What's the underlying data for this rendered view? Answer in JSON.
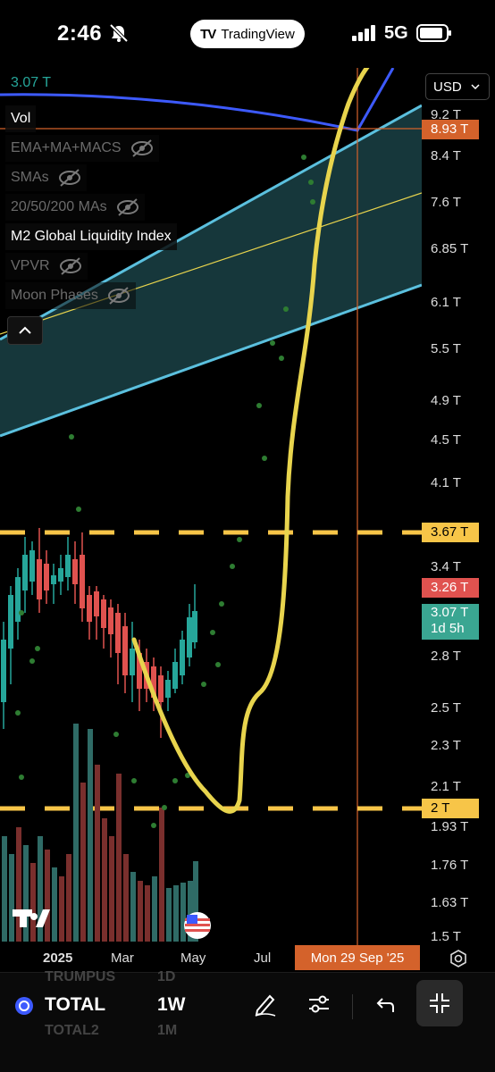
{
  "status_bar": {
    "time": "2:46",
    "app_name": "TradingView",
    "network": "5G"
  },
  "chart": {
    "legend_last_value": "3.07 T",
    "indicators": [
      {
        "name": "Vol",
        "visible": true
      },
      {
        "name": "EMA+MA+MACS",
        "visible": false
      },
      {
        "name": "SMAs",
        "visible": false
      },
      {
        "name": "20/50/200 MAs",
        "visible": false
      },
      {
        "name": "M2 Global Liquidity Index",
        "visible": true
      },
      {
        "name": "VPVR",
        "visible": false
      },
      {
        "name": "Moon Phases",
        "visible": false
      }
    ],
    "colors": {
      "up": "#26a69a",
      "down": "#e0524f",
      "liquidity_line": "#e8d44d",
      "channel": "#5bc0de",
      "dash": "#f7c548",
      "crosshair": "#d4622b",
      "ma_blue": "#3d5afe"
    }
  },
  "price_axis": {
    "currency": "USD",
    "ticks": [
      "9.2 T",
      "8.4 T",
      "7.6 T",
      "6.85 T",
      "6.1 T",
      "5.5 T",
      "4.9 T",
      "4.5 T",
      "4.1 T",
      "3.4 T",
      "2.8 T",
      "2.5 T",
      "2.3 T",
      "2.1 T",
      "1.93 T",
      "1.76 T",
      "1.63 T",
      "1.5 T"
    ],
    "crosshair_value": "8.93 T",
    "upper_level": "3.67 T",
    "lower_level": "2 T",
    "prev_close": "3.26 T",
    "last_price": "3.07 T",
    "countdown": "1d 5h"
  },
  "time_axis": {
    "year": "2025",
    "labels": [
      "Mar",
      "May",
      "Jul"
    ],
    "crosshair_date": "Mon 29 Sep '25"
  },
  "toolbar": {
    "symbol": "TOTAL",
    "interval": "1W",
    "ghost_above": [
      "TRUMPUS",
      "1D"
    ],
    "ghost_below": [
      "TOTAL2",
      "1M"
    ]
  }
}
